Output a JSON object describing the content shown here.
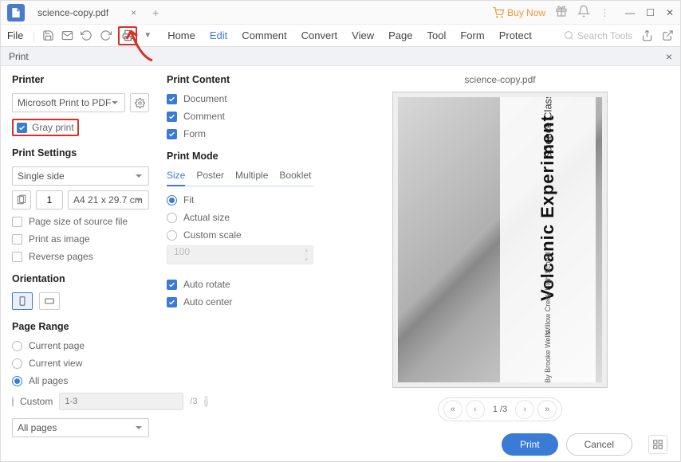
{
  "titlebar": {
    "tab_title": "science-copy.pdf",
    "buynow_label": "Buy Now"
  },
  "toolbar": {
    "file_label": "File",
    "search_placeholder": "Search Tools"
  },
  "menu": {
    "home": "Home",
    "edit": "Edit",
    "comment": "Comment",
    "convert": "Convert",
    "view": "View",
    "page": "Page",
    "tool": "Tool",
    "form": "Form",
    "protect": "Protect"
  },
  "print": {
    "dialog_title": "Print",
    "printer_section": "Printer",
    "printer_value": "Microsoft Print to PDF",
    "gray_print_label": "Gray print",
    "settings_section": "Print Settings",
    "side_value": "Single side",
    "copies_value": "1",
    "paper_value": "A4 21 x 29.7 cm",
    "src_size_label": "Page size of source file",
    "print_image_label": "Print as image",
    "reverse_label": "Reverse pages",
    "orientation_section": "Orientation",
    "range_section": "Page Range",
    "range_current_page": "Current page",
    "range_current_view": "Current view",
    "range_all_pages": "All pages",
    "range_custom": "Custom",
    "range_custom_placeholder": "1-3",
    "range_custom_suffix": "/3",
    "range_dropdown": "All pages"
  },
  "content": {
    "section": "Print Content",
    "document": "Document",
    "comment": "Comment",
    "form": "Form"
  },
  "mode": {
    "section": "Print Mode",
    "size": "Size",
    "poster": "Poster",
    "multiple": "Multiple",
    "booklet": "Booklet",
    "fit": "Fit",
    "actual": "Actual size",
    "custom": "Custom scale",
    "scale_placeholder": "100",
    "auto_rotate": "Auto rotate",
    "auto_center": "Auto center"
  },
  "preview": {
    "filename": "science-copy.pdf",
    "title_small": "Science Class",
    "title_big": "Volcanic Experiment",
    "subtitle1": "Willow Creek High School",
    "subtitle2": "By Brooke Wells",
    "pager_text": "1 /3"
  },
  "footer": {
    "print": "Print",
    "cancel": "Cancel"
  }
}
